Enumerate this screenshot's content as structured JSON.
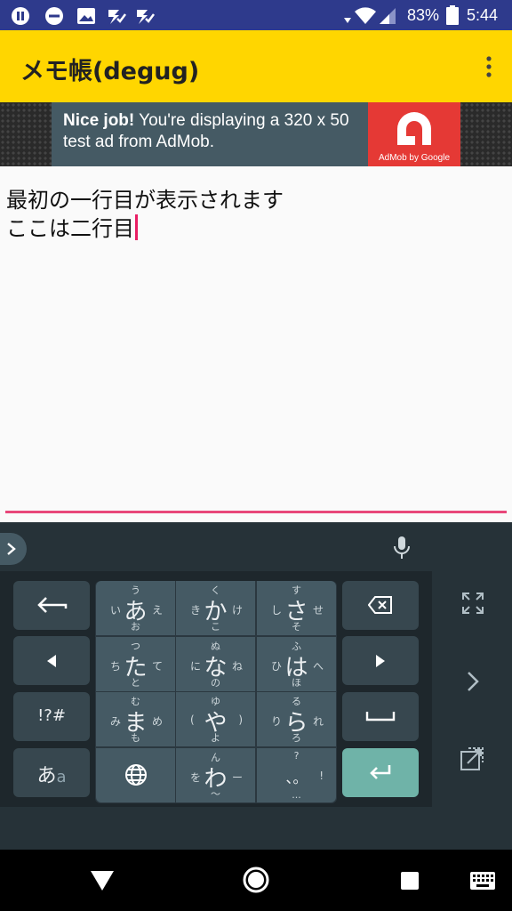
{
  "status": {
    "battery": "83%",
    "time": "5:44"
  },
  "app": {
    "title": "メモ帳(degug)"
  },
  "ad": {
    "bold": "Nice job!",
    "text": " You're displaying a 320 x 50 test ad from AdMob.",
    "logo_caption": "AdMob by Google"
  },
  "editor": {
    "line1": "最初の一行目が表示されます",
    "line2": "ここは二行目"
  },
  "keyboard": {
    "flick_keys": [
      {
        "main": "あ",
        "up": "う",
        "left": "い",
        "right": "え",
        "down": "お"
      },
      {
        "main": "か",
        "up": "く",
        "left": "き",
        "right": "け",
        "down": "こ"
      },
      {
        "main": "さ",
        "up": "す",
        "left": "し",
        "right": "せ",
        "down": "そ"
      },
      {
        "main": "た",
        "up": "つ",
        "left": "ち",
        "right": "て",
        "down": "と"
      },
      {
        "main": "な",
        "up": "ぬ",
        "left": "に",
        "right": "ね",
        "down": "の"
      },
      {
        "main": "は",
        "up": "ふ",
        "left": "ひ",
        "right": "へ",
        "down": "ほ"
      },
      {
        "main": "ま",
        "up": "む",
        "left": "み",
        "right": "め",
        "down": "も"
      },
      {
        "main": "や",
        "up": "ゆ",
        "left": "(",
        "right": ")",
        "down": "よ"
      },
      {
        "main": "ら",
        "up": "る",
        "left": "り",
        "right": "れ",
        "down": "ろ"
      },
      {
        "main": "わ",
        "up": "ん",
        "left": "を",
        "right": "ー",
        "down": "〜"
      },
      {
        "main": "、。",
        "up": "?",
        "left": "",
        "right": "!",
        "down": "..."
      }
    ],
    "symbols_label": "!?#",
    "mode_label_main": "あ",
    "mode_label_sub": "a"
  },
  "colors": {
    "status_bar": "#2e3a8c",
    "app_bar": "#ffd600",
    "accent": "#e91e63",
    "enter_key": "#6fb3a8"
  }
}
